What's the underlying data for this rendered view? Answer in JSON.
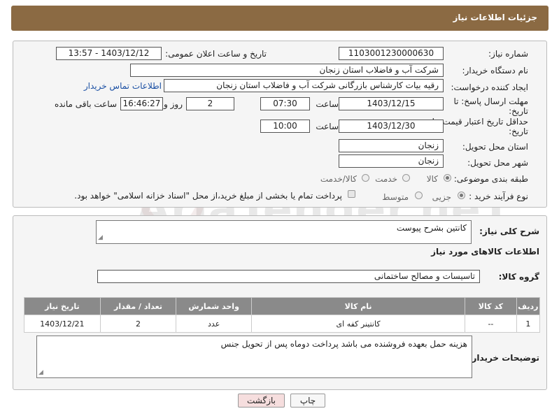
{
  "header": {
    "title": "جزئیات اطلاعات نیاز"
  },
  "form": {
    "need_number_label": "شماره نیاز:",
    "need_number": "1103001230000630",
    "announce_label": "تاریخ و ساعت اعلان عمومی:",
    "announce_value": "1403/12/12 - 13:57",
    "buyer_org_label": "نام دستگاه خریدار:",
    "buyer_org": "شرکت آب و فاضلاب استان زنجان",
    "creator_label": "ایجاد کننده درخواست:",
    "creator": "رقیه بیات کارشناس بازرگانی شرکت آب و فاضلاب استان زنجان",
    "contact_link": "اطلاعات تماس خریدار",
    "deadline_label_1": "مهلت ارسال پاسخ: تا",
    "deadline_label_2": "تاریخ:",
    "deadline_date": "1403/12/15",
    "time_word": "ساعت",
    "deadline_time": "07:30",
    "days_value": "2",
    "days_word": "روز و",
    "remaining_time": "16:46:27",
    "remaining_word": "ساعت باقی مانده",
    "validity_label_1": "حداقل تاریخ اعتبار قیمت: تا",
    "validity_label_2": "تاریخ:",
    "validity_date": "1403/12/30",
    "validity_time": "10:00",
    "province_label": "استان محل تحویل:",
    "province": "زنجان",
    "city_label": "شهر محل تحویل:",
    "city": "زنجان",
    "category_label": "طبقه بندی موضوعی:",
    "category_options": [
      "کالا",
      "خدمت",
      "کالا/خدمت"
    ],
    "process_label": "نوع فرآیند خرید :",
    "process_options": [
      "جزیی",
      "متوسط"
    ],
    "payment_note": "پرداخت تمام یا بخشی از مبلغ خرید،از محل \"اسناد خزانه اسلامی\" خواهد بود."
  },
  "details": {
    "summary_label": "شرح کلی نیاز:",
    "summary": "کانتین بشرح پیوست",
    "goods_info_title": "اطلاعات کالاهای مورد نیاز",
    "group_label": "گروه کالا:",
    "group": "تاسیسات و مصالح ساختمانی",
    "columns": [
      "ردیف",
      "کد کالا",
      "نام کالا",
      "واحد شمارش",
      "تعداد / مقدار",
      "تاریخ نیاز"
    ],
    "rows": [
      [
        "1",
        "--",
        "کانتینر کفه ای",
        "عدد",
        "2",
        "1403/12/21"
      ]
    ],
    "buyer_notes_label": "توضیحات خریدار:",
    "buyer_notes": "هزینه حمل بعهده فروشنده می باشد پرداخت دوماه پس از تحویل جنس"
  },
  "buttons": {
    "print": "چاپ",
    "back": "بازگشت"
  },
  "watermark": {
    "text": "AriaTender.neT"
  },
  "colors": {
    "header_bg": "#8b6a43",
    "link": "#1a4fa3",
    "table_header": "#8a8a8a",
    "back_button": "#f6dede"
  }
}
